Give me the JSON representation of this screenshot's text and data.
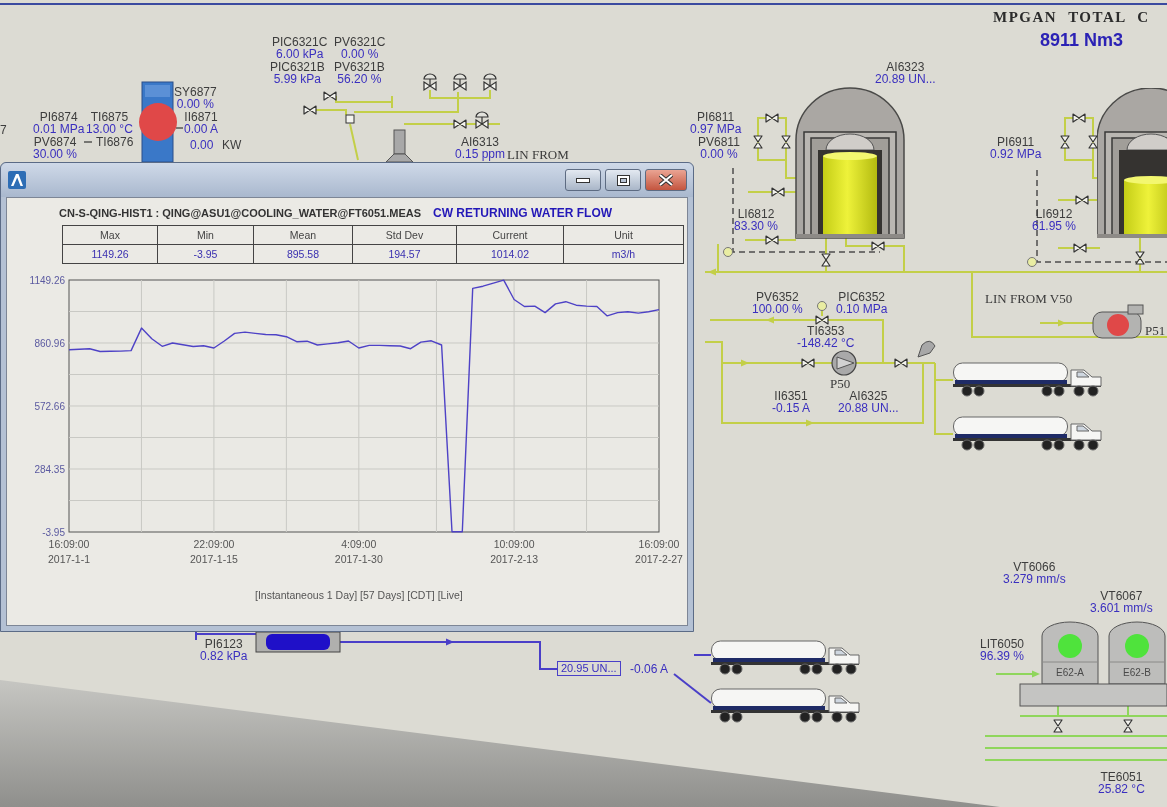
{
  "plant_total": {
    "title": "MPGAN TOTAL C",
    "value": "8911 Nm3"
  },
  "tags": [
    {
      "label": "PIC6321C",
      "value": "6.00 kPa"
    },
    {
      "label": "PV6321C",
      "value": "0.00 %"
    },
    {
      "label": "PIC6321B",
      "value": "5.99 kPa"
    },
    {
      "label": "PV6321B",
      "value": "56.20 %"
    },
    {
      "label": "AI6323",
      "value": "20.89 UN..."
    },
    {
      "label": "SY6877",
      "value": "0.00 %"
    },
    {
      "label": "PI6874",
      "value": "0.01 MPa"
    },
    {
      "label": "TI6875",
      "value": "13.00 °C"
    },
    {
      "label": "II6871",
      "value": "0.00 A"
    },
    {
      "label": "PI6811",
      "value": "0.97 MPa"
    },
    {
      "label": "PV6874",
      "value": "30.00 %"
    },
    {
      "label": "TI6876"
    },
    {
      "label": "AI6313",
      "value": "0.15 ppm"
    },
    {
      "label": "PV6811",
      "value": "0.00 %"
    },
    {
      "label": "PI6911",
      "value": "0.92 MPa"
    },
    {
      "label": "LI6812",
      "value": "83.30 %"
    },
    {
      "label": "LI6912",
      "value": "61.95 %"
    },
    {
      "label": "PV6352",
      "value": "100.00 %"
    },
    {
      "label": "PIC6352",
      "value": "0.10 MPa"
    },
    {
      "label": "TI6353",
      "value": "-148.42 °C"
    },
    {
      "label": "II6351",
      "value": "-0.15 A"
    },
    {
      "label": "AI6325",
      "value": "20.88 UN..."
    },
    {
      "label": "VT6066",
      "value": "3.279 mm/s"
    },
    {
      "label": "VT6067",
      "value": "3.601 mm/s"
    },
    {
      "label": "PI6123",
      "value": "0.82 kPa"
    },
    {
      "label": "LIT6050",
      "value": "96.39 %"
    },
    {
      "label": "TE6051",
      "value": "25.82 °C"
    }
  ],
  "captions": [
    {
      "text": "7",
      "kind": "plain"
    },
    {
      "text": "0.00",
      "kind": "reading"
    },
    {
      "text": "KW",
      "kind": "plain"
    },
    {
      "text": "LIN FROM",
      "kind": "serif"
    },
    {
      "text": "LIN FROM V50",
      "kind": "serif"
    },
    {
      "text": "20.95 UN...",
      "kind": "boxed"
    },
    {
      "text": "-0.06 A",
      "kind": "reading"
    }
  ],
  "motors": [
    {
      "color": "#e04848"
    }
  ],
  "pumps": [
    {
      "label": "P50"
    },
    {
      "label": "P51",
      "color": "#e04848"
    }
  ],
  "vessels": [
    {
      "label": "E62-A",
      "color": "#4fe33c"
    },
    {
      "label": "E62-B",
      "color": "#4fe33c"
    }
  ],
  "trend_window": {
    "source": "CN-S-QING-HIST1 : QING@ASU1@COOLING_WATER@FT6051.MEAS",
    "description": "CW RETURNING WATER FLOW",
    "stats": {
      "columns": [
        "Max",
        "Min",
        "Mean",
        "Std Dev",
        "Current",
        "Unit"
      ],
      "values": [
        "1149.26",
        "-3.95",
        "895.58",
        "194.57",
        "1014.02",
        "m3/h"
      ]
    },
    "chart_data": {
      "type": "line",
      "grid": true,
      "categories": [
        "16:09:00 2017-1-1",
        null,
        null,
        null,
        null,
        null,
        null,
        null,
        null,
        null,
        null,
        null,
        null,
        null,
        "22:09:00 2017-1-15",
        null,
        null,
        null,
        null,
        null,
        null,
        null,
        null,
        null,
        null,
        null,
        null,
        null,
        "4:09:00 2017-1-30",
        null,
        null,
        null,
        null,
        null,
        null,
        null,
        null,
        null,
        null,
        null,
        null,
        null,
        null,
        "10:09:00 2017-2-13",
        null,
        null,
        null,
        null,
        null,
        null,
        null,
        null,
        null,
        null,
        null,
        null,
        null,
        "16:09:00 2017-2-27"
      ],
      "values": [
        830,
        832,
        835,
        822,
        823,
        824,
        826,
        929,
        880,
        846,
        861,
        853,
        845,
        848,
        838,
        870,
        905,
        911,
        905,
        900,
        899,
        890,
        867,
        869,
        852,
        857,
        862,
        870,
        838,
        850,
        850,
        848,
        847,
        835,
        865,
        871,
        852,
        -3,
        -3,
        1111,
        1121,
        1135,
        1149,
        1060,
        1028,
        1030,
        1000,
        1040,
        1050,
        1034,
        1030,
        1028,
        985,
        1000,
        1004,
        998,
        1004,
        1014
      ],
      "ylim": [
        -3.95,
        1149.26
      ],
      "yticks": [
        -3.95,
        284.35,
        572.66,
        860.96,
        1149.26
      ]
    },
    "caption": "[Instantaneous 1 Day] [57 Days] [CDT] [Live]"
  }
}
